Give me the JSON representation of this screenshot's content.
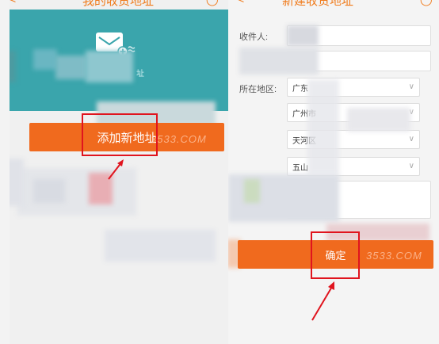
{
  "left_screen": {
    "title": "我的收货地址",
    "banner_text": "址",
    "add_button_label": "添加新地址"
  },
  "right_screen": {
    "title": "新建收货地址",
    "recipient_label": "收件人:",
    "region_label": "所在地区:",
    "province_value": "广东",
    "city_value": "广州市",
    "district_value": "天河区",
    "street_value": "五山",
    "confirm_button_label": "确定"
  },
  "watermark_text": "3533.COM",
  "colors": {
    "accent": "#f06a1e",
    "banner": "#3aa5ac",
    "highlight_box": "#e0141e"
  }
}
